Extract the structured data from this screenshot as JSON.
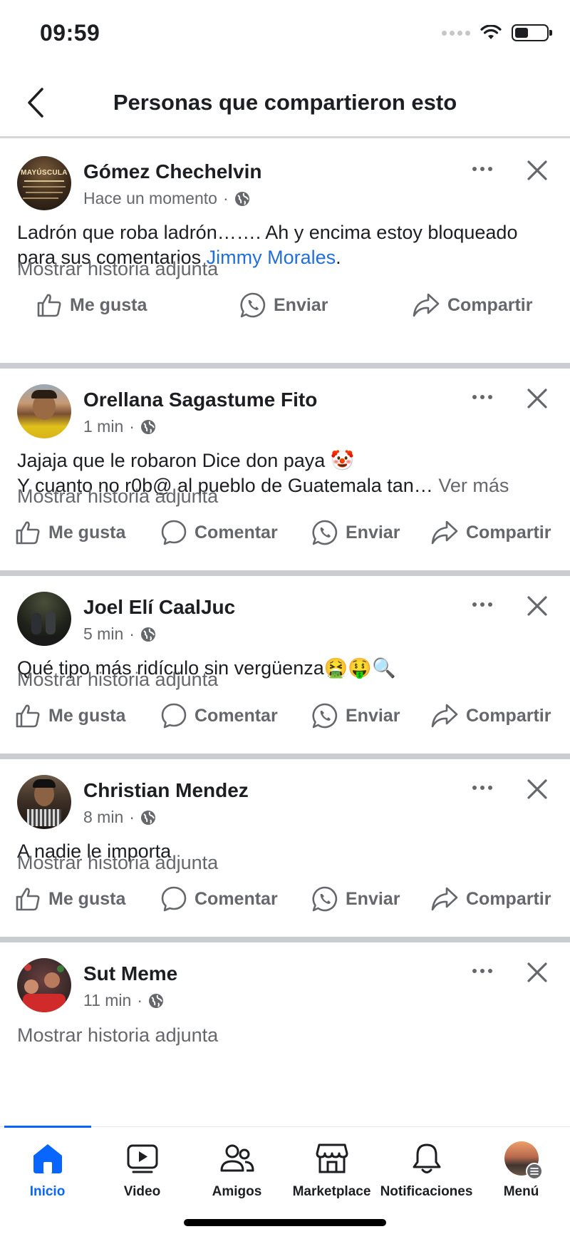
{
  "status_bar": {
    "time": "09:59"
  },
  "header": {
    "title": "Personas que compartieron esto"
  },
  "posts": [
    {
      "author": "Gómez Chechelvin",
      "time": "Hace un momento",
      "text": "Ladrón que roba ladrón……. Ah y encima estoy bloqueado para sus comentarios ",
      "mention": "Jimmy Morales",
      "text_end": ".",
      "attached": "Mostrar historia adjunta",
      "actions": {
        "like": "Me gusta",
        "send": "Enviar",
        "share": "Compartir"
      }
    },
    {
      "author": "Orellana Sagastume Fito",
      "time": "1 min",
      "text_line1": "Jajaja que le robaron Dice don paya 🤡",
      "text_line2": "Y cuanto no r0b@ al pueblo de Guatemala tan… ",
      "see_more": "Ver más",
      "attached": "Mostrar historia adjunta",
      "actions": {
        "like": "Me gusta",
        "comment": "Comentar",
        "send": "Enviar",
        "share": "Compartir"
      }
    },
    {
      "author": "Joel Elí CaalJuc",
      "time": "5 min",
      "text": "Qué tipo más ridículo sin vergüenza🤮🤑🔍",
      "attached": "Mostrar historia adjunta",
      "actions": {
        "like": "Me gusta",
        "comment": "Comentar",
        "send": "Enviar",
        "share": "Compartir"
      }
    },
    {
      "author": "Christian Mendez",
      "time": "8 min",
      "text": "A nadie le importa",
      "attached": "Mostrar historia adjunta",
      "actions": {
        "like": "Me gusta",
        "comment": "Comentar",
        "send": "Enviar",
        "share": "Compartir"
      }
    },
    {
      "author": "Sut Meme",
      "time": "11 min",
      "attached": "Mostrar historia adjunta"
    }
  ],
  "avatar1_text": "MAYÚSCULA",
  "bottom_nav": [
    {
      "label": "Inicio",
      "icon": "home-icon",
      "active": true
    },
    {
      "label": "Video",
      "icon": "video-icon"
    },
    {
      "label": "Amigos",
      "icon": "friends-icon"
    },
    {
      "label": "Marketplace",
      "icon": "marketplace-icon"
    },
    {
      "label": "Notificaciones",
      "icon": "bell-icon"
    },
    {
      "label": "Menú",
      "icon": "menu-avatar"
    }
  ],
  "colors": {
    "accent": "#0866ff",
    "link": "#216fdb",
    "secondary_text": "#65676b"
  }
}
